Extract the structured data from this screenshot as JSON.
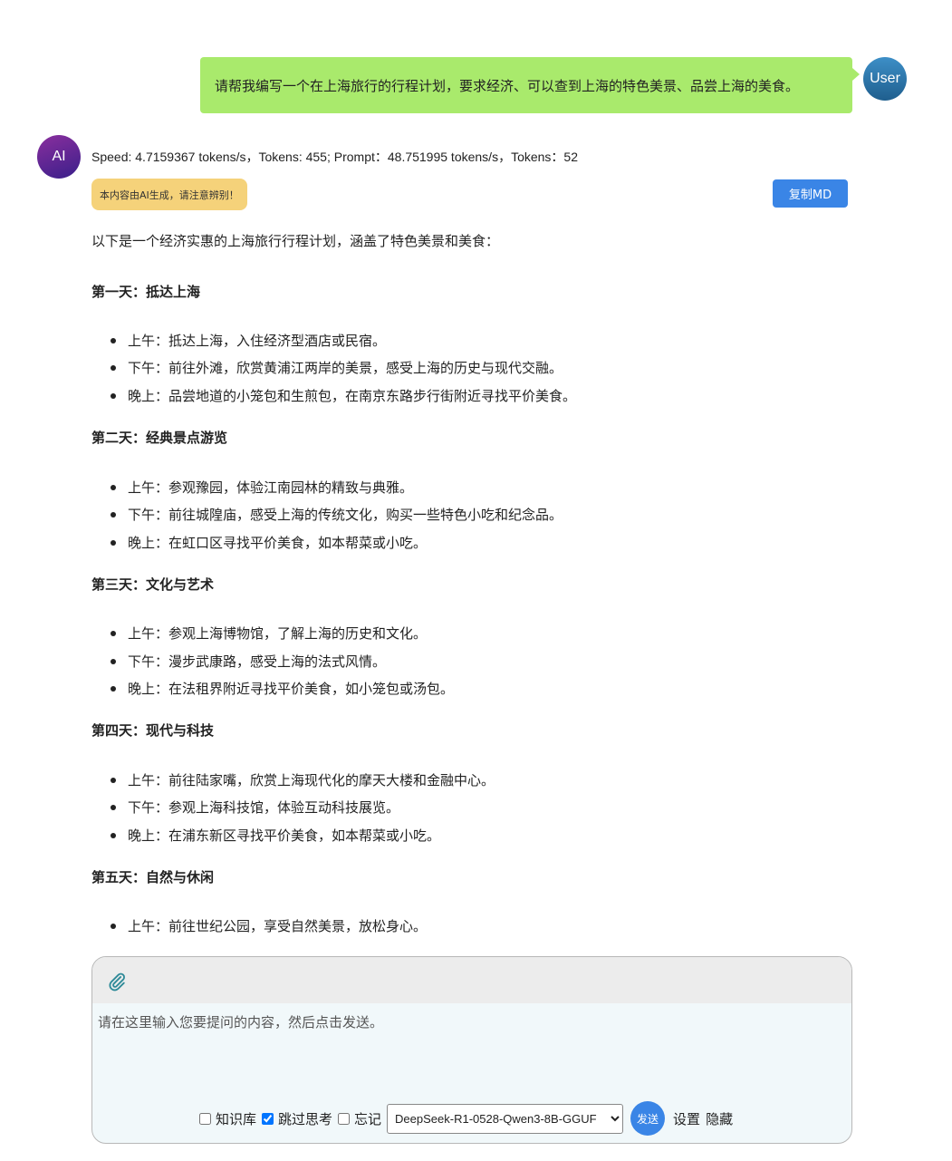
{
  "user_message": {
    "text": "请帮我编写一个在上海旅行的行程计划，要求经济、可以查到上海的特色美景、品尝上海的美食。",
    "avatar_label": "User"
  },
  "ai_message": {
    "avatar_label": "AI",
    "stats": "Speed: 4.7159367 tokens/s，Tokens: 455; Prompt：48.751995 tokens/s，Tokens：52",
    "warning": "本内容由AI生成，请注意辨别！",
    "copy_label": "复制MD",
    "intro": "以下是一个经济实惠的上海旅行行程计划，涵盖了特色美景和美食：",
    "days": [
      {
        "title": "第一天：抵达上海",
        "items": [
          "上午：抵达上海，入住经济型酒店或民宿。",
          "下午：前往外滩，欣赏黄浦江两岸的美景，感受上海的历史与现代交融。",
          "晚上：品尝地道的小笼包和生煎包，在南京东路步行街附近寻找平价美食。"
        ]
      },
      {
        "title": "第二天：经典景点游览",
        "items": [
          "上午：参观豫园，体验江南园林的精致与典雅。",
          "下午：前往城隍庙，感受上海的传统文化，购买一些特色小吃和纪念品。",
          "晚上：在虹口区寻找平价美食，如本帮菜或小吃。"
        ]
      },
      {
        "title": "第三天：文化与艺术",
        "items": [
          "上午：参观上海博物馆，了解上海的历史和文化。",
          "下午：漫步武康路，感受上海的法式风情。",
          "晚上：在法租界附近寻找平价美食，如小笼包或汤包。"
        ]
      },
      {
        "title": "第四天：现代与科技",
        "items": [
          "上午：前往陆家嘴，欣赏上海现代化的摩天大楼和金融中心。",
          "下午：参观上海科技馆，体验互动科技展览。",
          "晚上：在浦东新区寻找平价美食，如本帮菜或小吃。"
        ]
      },
      {
        "title": "第五天：自然与休闲",
        "items": [
          "上午：前往世纪公园，享受自然美景，放松身心。"
        ]
      }
    ]
  },
  "input_panel": {
    "placeholder": "请在这里输入您要提问的内容，然后点击发送。",
    "knowledge_label": "知识库",
    "knowledge_checked": false,
    "skip_think_label": "跳过思考",
    "skip_think_checked": true,
    "forget_label": "忘记",
    "forget_checked": false,
    "model_selected": "DeepSeek-R1-0528-Qwen3-8B-GGUF",
    "send_label": "发送",
    "settings_label": "设置",
    "hide_label": "隐藏",
    "attach_icon": "paperclip-icon"
  },
  "colors": {
    "user_bubble": "#a9ea6c",
    "accent_blue": "#3a85e6",
    "warning_bg": "#f5d27a"
  }
}
